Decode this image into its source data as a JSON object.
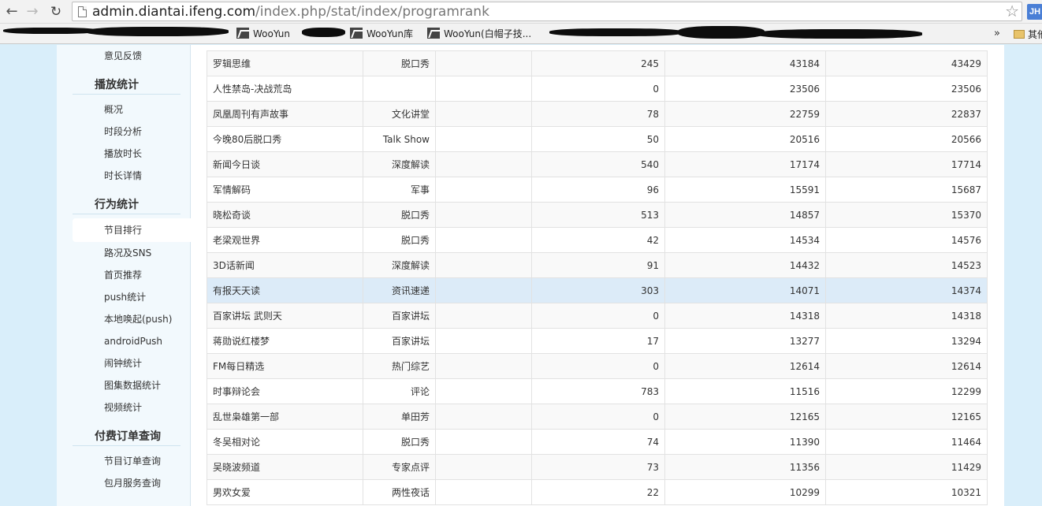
{
  "browser": {
    "url_host": "admin.diantai.ifeng.com",
    "url_path": "/index.php/stat/index/programrank",
    "ext_label": "JH",
    "bookmarks": [
      "WooYun",
      "WooYun库",
      "WooYun(白帽子技..."
    ],
    "more_label": "»",
    "folder_label": "其他"
  },
  "sidebar": {
    "top_item": "意见反馈",
    "groups": [
      {
        "title": "播放统计",
        "items": [
          "概况",
          "时段分析",
          "播放时长",
          "时长详情"
        ]
      },
      {
        "title": "行为统计",
        "items": [
          "节目排行",
          "路况及SNS",
          "首页推荐",
          "push统计",
          "本地唤起(push)",
          "androidPush",
          "闹钟统计",
          "图集数据统计",
          "视频统计"
        ]
      },
      {
        "title": "付费订单查询",
        "items": [
          "节目订单查询",
          "包月服务查询"
        ]
      }
    ],
    "active_item": "节目排行"
  },
  "table": {
    "highlighted_row": 9,
    "rows": [
      {
        "name": "罗辑思维",
        "category": "脱口秀",
        "extra": "",
        "v1": "245",
        "v2": "43184",
        "total": "43429"
      },
      {
        "name": "人性禁岛-决战荒岛",
        "category": "",
        "extra": "",
        "v1": "0",
        "v2": "23506",
        "total": "23506"
      },
      {
        "name": "凤凰周刊有声故事",
        "category": "文化讲堂",
        "extra": "",
        "v1": "78",
        "v2": "22759",
        "total": "22837"
      },
      {
        "name": "今晚80后脱口秀",
        "category": "Talk Show",
        "extra": "",
        "v1": "50",
        "v2": "20516",
        "total": "20566"
      },
      {
        "name": "新闻今日谈",
        "category": "深度解读",
        "extra": "",
        "v1": "540",
        "v2": "17174",
        "total": "17714"
      },
      {
        "name": "军情解码",
        "category": "军事",
        "extra": "",
        "v1": "96",
        "v2": "15591",
        "total": "15687"
      },
      {
        "name": "晓松奇谈",
        "category": "脱口秀",
        "extra": "",
        "v1": "513",
        "v2": "14857",
        "total": "15370"
      },
      {
        "name": "老梁观世界",
        "category": "脱口秀",
        "extra": "",
        "v1": "42",
        "v2": "14534",
        "total": "14576"
      },
      {
        "name": "3D话新闻",
        "category": "深度解读",
        "extra": "",
        "v1": "91",
        "v2": "14432",
        "total": "14523"
      },
      {
        "name": "有报天天读",
        "category": "资讯速递",
        "extra": "",
        "v1": "303",
        "v2": "14071",
        "total": "14374"
      },
      {
        "name": "百家讲坛 武则天",
        "category": "百家讲坛",
        "extra": "",
        "v1": "0",
        "v2": "14318",
        "total": "14318"
      },
      {
        "name": "蒋勋说红楼梦",
        "category": "百家讲坛",
        "extra": "",
        "v1": "17",
        "v2": "13277",
        "total": "13294"
      },
      {
        "name": "FM每日精选",
        "category": "热门综艺",
        "extra": "",
        "v1": "0",
        "v2": "12614",
        "total": "12614"
      },
      {
        "name": "时事辩论会",
        "category": "评论",
        "extra": "",
        "v1": "783",
        "v2": "11516",
        "total": "12299"
      },
      {
        "name": "乱世枭雄第一部",
        "category": "单田芳",
        "extra": "",
        "v1": "0",
        "v2": "12165",
        "total": "12165"
      },
      {
        "name": "冬吴相对论",
        "category": "脱口秀",
        "extra": "",
        "v1": "74",
        "v2": "11390",
        "total": "11464"
      },
      {
        "name": "吴晓波频道",
        "category": "专家点评",
        "extra": "",
        "v1": "73",
        "v2": "11356",
        "total": "11429"
      },
      {
        "name": "男欢女爱",
        "category": "两性夜话",
        "extra": "",
        "v1": "22",
        "v2": "10299",
        "total": "10321"
      }
    ]
  }
}
